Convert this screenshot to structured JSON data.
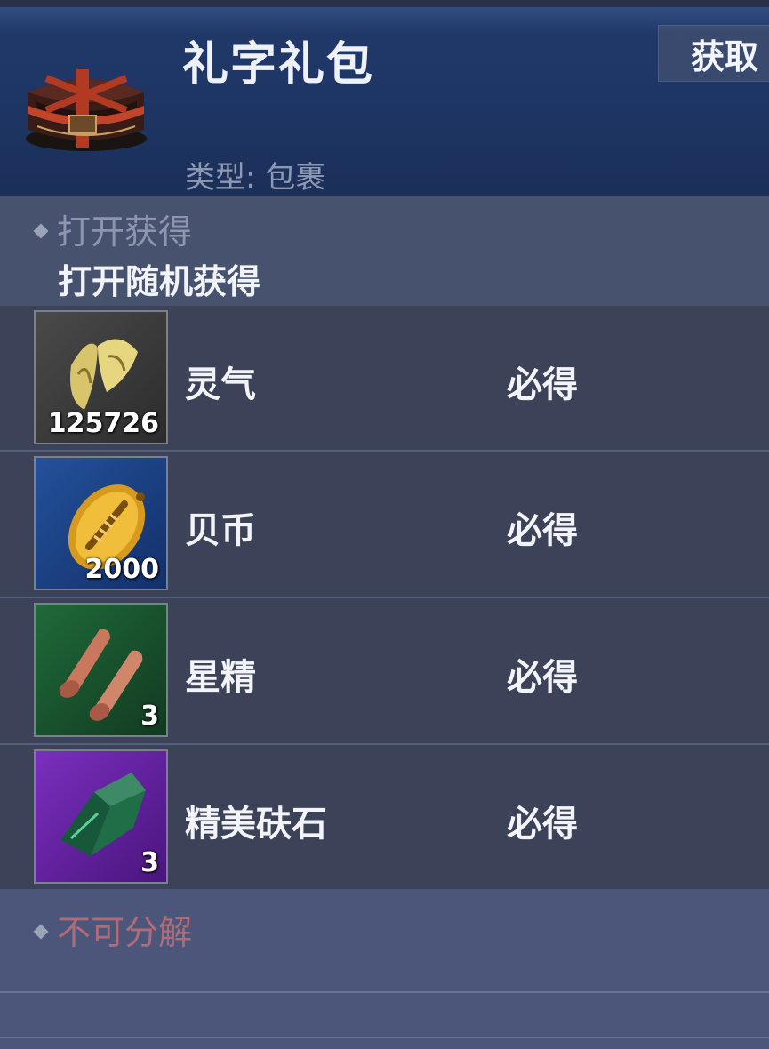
{
  "header": {
    "title": "礼字礼包",
    "type_label": "类型:",
    "type_value": "包裹",
    "acquire_label": "获取",
    "package_icon": "gift-chest-icon"
  },
  "open_section": {
    "heading": "打开获得",
    "description": "打开随机获得"
  },
  "items": [
    {
      "name": "灵气",
      "quantity": "125726",
      "guarantee": "必得",
      "icon": "spirit-leaves-icon"
    },
    {
      "name": "贝币",
      "quantity": "2000",
      "guarantee": "必得",
      "icon": "shell-coin-icon"
    },
    {
      "name": "星精",
      "quantity": "3",
      "guarantee": "必得",
      "icon": "star-essence-icon"
    },
    {
      "name": "精美砆石",
      "quantity": "3",
      "guarantee": "必得",
      "icon": "fine-stone-icon"
    }
  ],
  "decompose": {
    "heading": "不可分解"
  },
  "colors": {
    "header_bg": "#1e3564",
    "panel_bg": "#3c4258",
    "section_bg": "#47526f",
    "warning_text": "#b06b78"
  }
}
